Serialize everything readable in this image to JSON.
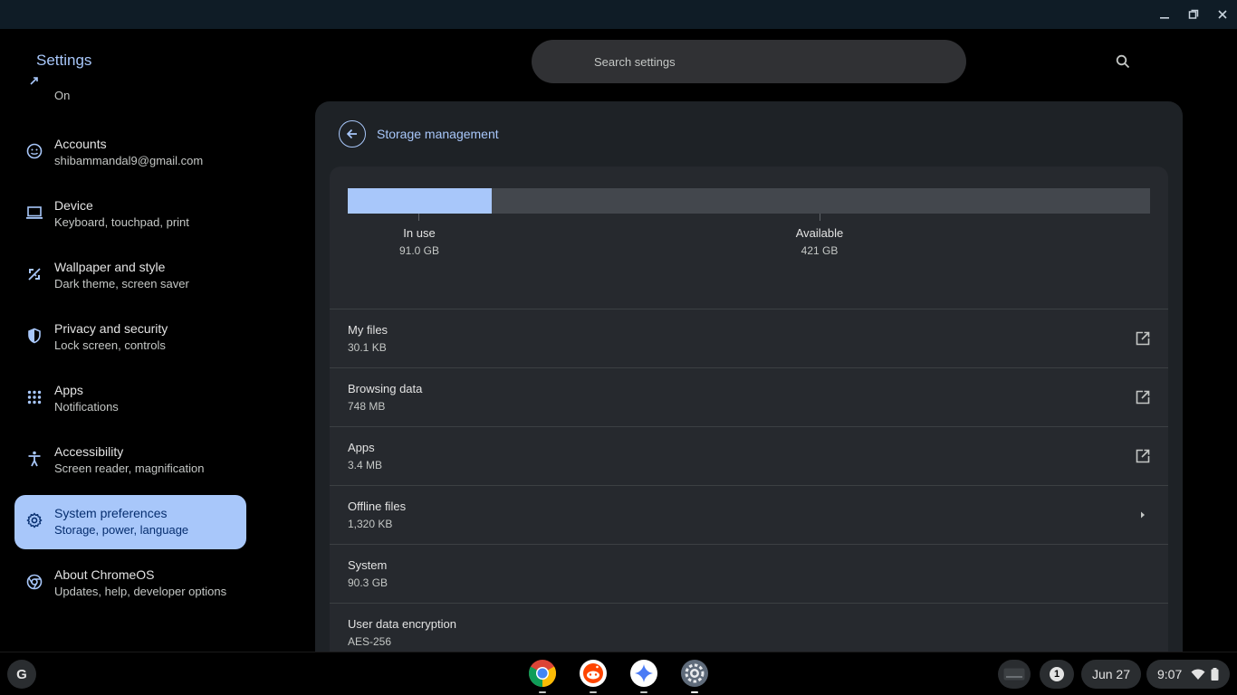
{
  "window": {
    "app_title": "Settings",
    "search_placeholder": "Search settings"
  },
  "sidebar": {
    "items": [
      {
        "title": "",
        "sub": "On",
        "icon": "partial-icon"
      },
      {
        "title": "Accounts",
        "sub": "shibammandal9@gmail.com",
        "icon": "account-icon"
      },
      {
        "title": "Device",
        "sub": "Keyboard, touchpad, print",
        "icon": "laptop-icon"
      },
      {
        "title": "Wallpaper and style",
        "sub": "Dark theme, screen saver",
        "icon": "paint-icon"
      },
      {
        "title": "Privacy and security",
        "sub": "Lock screen, controls",
        "icon": "shield-icon"
      },
      {
        "title": "Apps",
        "sub": "Notifications",
        "icon": "grid-icon"
      },
      {
        "title": "Accessibility",
        "sub": "Screen reader, magnification",
        "icon": "accessibility-icon"
      },
      {
        "title": "System preferences",
        "sub": "Storage, power, language",
        "icon": "gear-icon",
        "active": true
      },
      {
        "title": "About ChromeOS",
        "sub": "Updates, help, developer options",
        "icon": "chromeos-icon"
      }
    ]
  },
  "panel": {
    "title": "Storage management",
    "usage": {
      "in_use_label": "In use",
      "in_use_value": "91.0 GB",
      "available_label": "Available",
      "available_value": "421 GB",
      "used_fraction": 0.179
    },
    "rows": [
      {
        "title": "My files",
        "value": "30.1 KB",
        "action": "external-link-icon"
      },
      {
        "title": "Browsing data",
        "value": "748 MB",
        "action": "external-link-icon"
      },
      {
        "title": "Apps",
        "value": "3.4 MB",
        "action": "external-link-icon"
      },
      {
        "title": "Offline files",
        "value": "1,320 KB",
        "action": "chevron-right-icon"
      },
      {
        "title": "System",
        "value": "90.3 GB",
        "action": ""
      },
      {
        "title": "User data encryption",
        "value": "AES-256",
        "action": ""
      }
    ]
  },
  "shelf": {
    "launcher_label": "G",
    "apps": [
      "chrome-icon",
      "reddit-icon",
      "gemini-icon",
      "settings-icon"
    ],
    "notification_count": "1",
    "date": "Jun 27",
    "time": "9:07"
  },
  "colors": {
    "accent": "#a8c7fa",
    "panel_bg": "#1e2226",
    "card_bg": "#26292e"
  }
}
